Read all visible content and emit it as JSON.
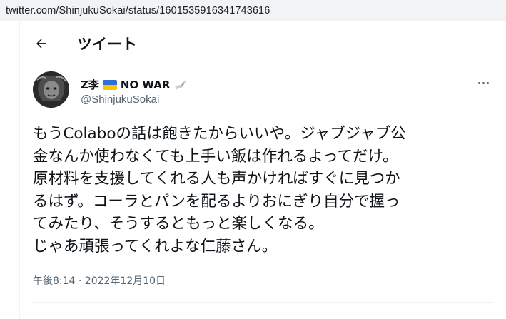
{
  "browser": {
    "url": "twitter.com/ShinjukuSokai/status/1601535916341743616"
  },
  "header": {
    "title": "ツイート",
    "back_icon": "arrow-left-icon"
  },
  "tweet": {
    "author": {
      "display_name_prefix": "Z李",
      "display_name_suffix": "NO WAR",
      "handle": "@ShinjukuSokai",
      "flag_colors": {
        "top": "#2f6fd6",
        "bottom": "#f6c700"
      }
    },
    "text": "もうColaboの話は飽きたからいいや。ジャブジャブ公\n金なんか使わなくても上手い飯は作れるよってだけ。\n原材料を支援してくれる人も声かければすぐに見つか\nるはず。コーラとパンを配るよりおにぎり自分で握っ\nてみたり、そうするともっと楽しくなる。\nじゃあ頑張ってくれよな仁藤さん。",
    "timestamp": "午後8:14 · 2022年12月10日"
  },
  "colors": {
    "text_primary": "#0f1419",
    "text_secondary": "#536471",
    "border": "#eff3f4"
  }
}
